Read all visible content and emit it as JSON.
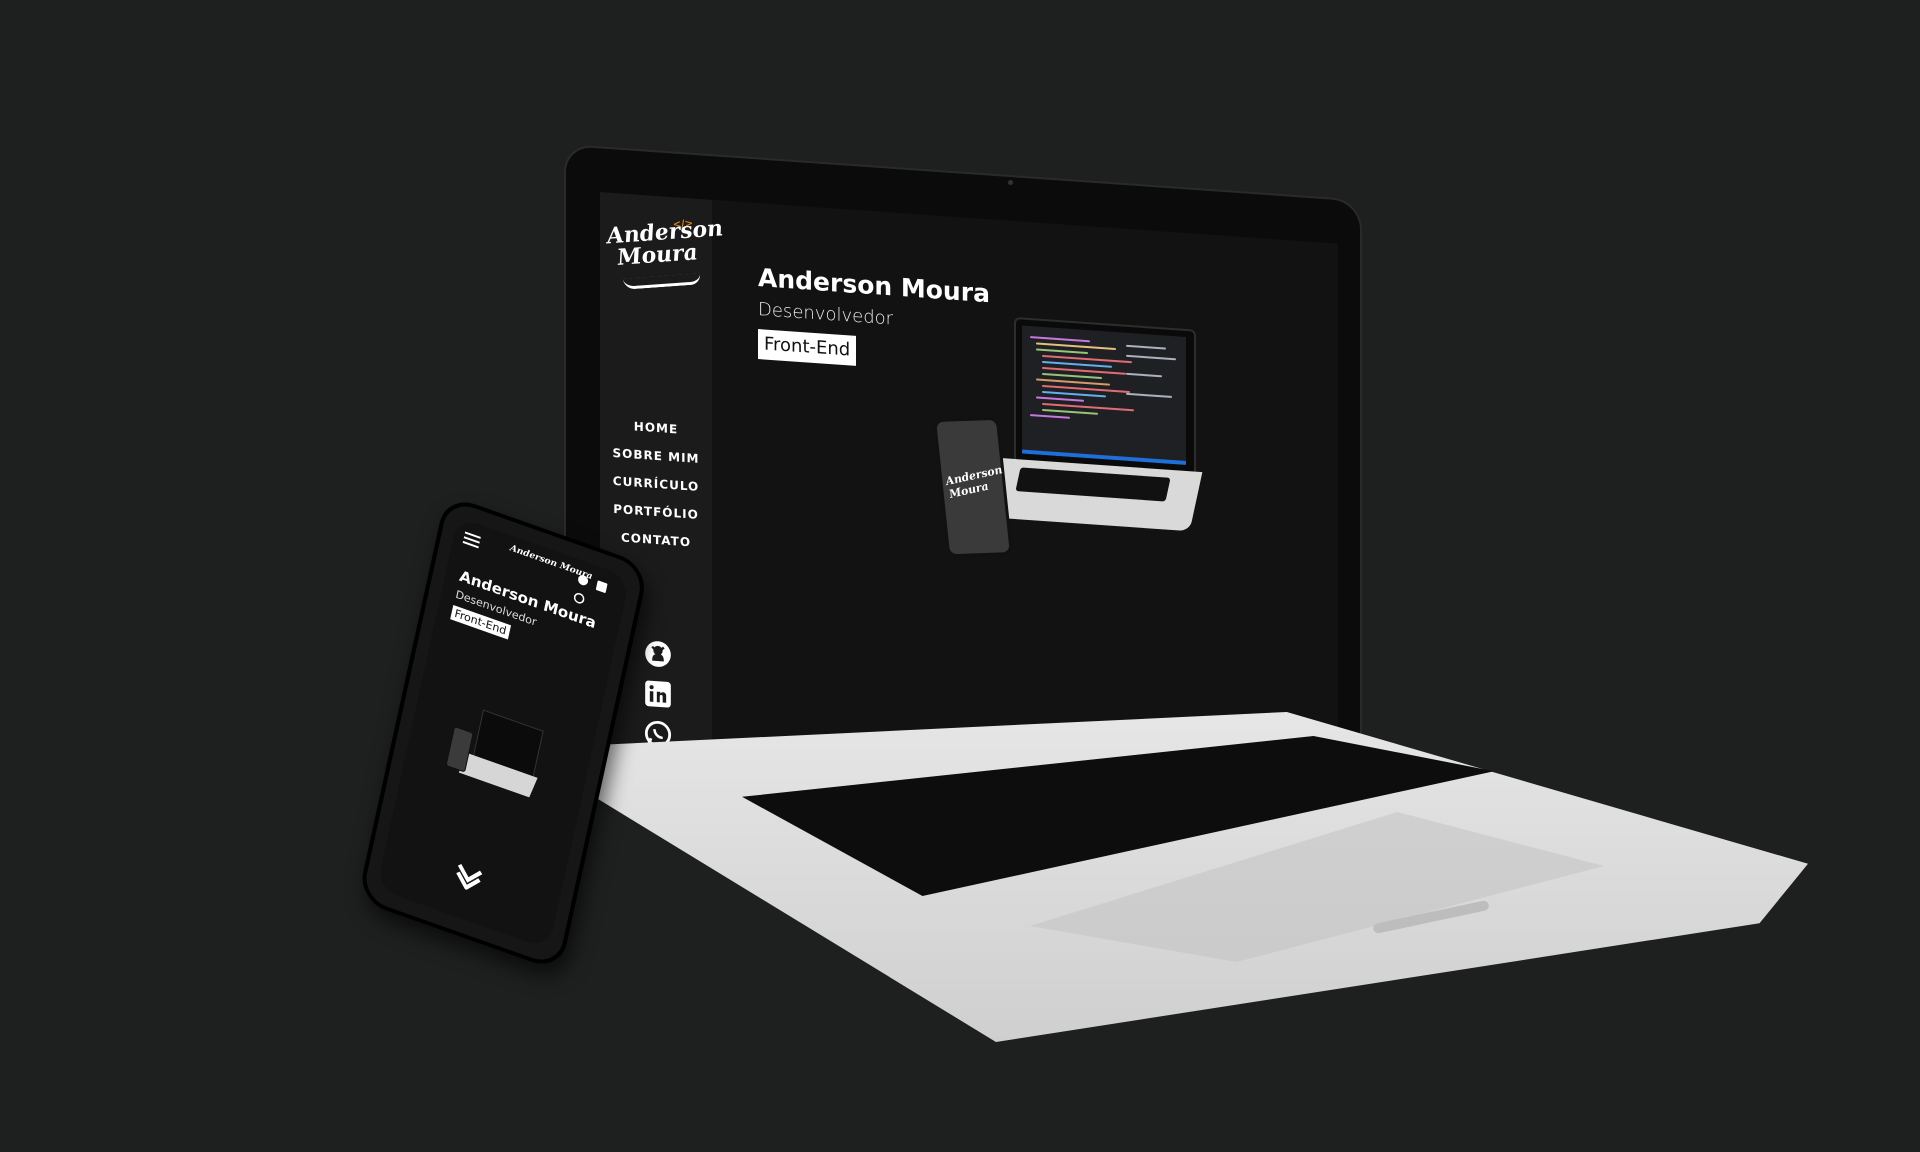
{
  "brand": {
    "logo_text_line1": "Anderson",
    "logo_text_line2": "Moura",
    "logo_tag": "</>"
  },
  "nav": {
    "items": [
      {
        "label": "HOME"
      },
      {
        "label": "SOBRE MIM"
      },
      {
        "label": "CURRÍCULO"
      },
      {
        "label": "PORTFÓLIO"
      },
      {
        "label": "CONTATO"
      }
    ]
  },
  "hero": {
    "name": "Anderson Moura",
    "role": "Desenvolvedor",
    "badge": "Front-End"
  },
  "social": [
    {
      "icon": "github-icon"
    },
    {
      "icon": "linkedin-icon"
    },
    {
      "icon": "whatsapp-icon"
    }
  ],
  "mobile": {
    "logo": "Anderson Moura",
    "name": "Anderson Moura",
    "role": "Desenvolvedor",
    "badge": "Front-End"
  },
  "colors": {
    "background": "#1e1f1f",
    "screen": "#121212",
    "sidebar": "#1b1b1b",
    "accent": "#d8821c",
    "text": "#ffffff"
  }
}
